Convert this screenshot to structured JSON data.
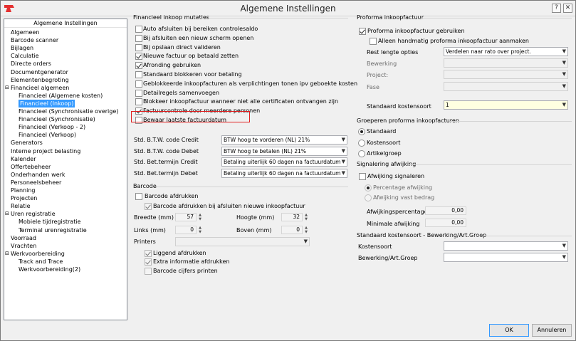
{
  "window": {
    "title": "Algemene Instellingen"
  },
  "tree": {
    "header": "Algemene Instellingen",
    "items": [
      "Algemeen",
      "Barcode scanner",
      "Bijlagen",
      "Calculatie",
      "Directe orders",
      "Documentgenerator",
      "Elementenbegroting",
      "Financieel algemeen",
      "Financieel (Algemene kosten)",
      "Financieel (Inkoop)",
      "Financieel (Synchronisatie overige)",
      "Financieel (Synchronisatie)",
      "Financieel (Verkoop - 2)",
      "Financieel (Verkoop)",
      "Generators",
      "Interne project belasting",
      "Kalender",
      "Offertebeheer",
      "Onderhanden werk",
      "Personeelsbeheer",
      "Planning",
      "Projecten",
      "Relatie",
      "Uren registratie",
      "Mobiele tijdregistratie",
      "Terminal urenregistratie",
      "Voorraad",
      "Vrachten",
      "Werkvoorbereiding",
      "Track and Trace",
      "Werkvoorbereiding(2)"
    ]
  },
  "mutaties": {
    "header": "Financieel inkoop mutaties",
    "checks": [
      {
        "label": "Auto afsluiten bij bereiken controlesaldo",
        "checked": false
      },
      {
        "label": "Bij afsluiten een nieuw scherm openen",
        "checked": false
      },
      {
        "label": "Bij opslaan direct valideren",
        "checked": false
      },
      {
        "label": "Nieuwe factuur op betaald zetten",
        "checked": true
      },
      {
        "label": "Afronding gebruiken",
        "checked": true
      },
      {
        "label": "Standaard blokkeren voor betaling",
        "checked": false
      },
      {
        "label": "Geblokkeerde inkoopfacturen als verplichtingen tonen ipv geboekte kosten",
        "checked": false
      },
      {
        "label": "Detailregels samenvoegen",
        "checked": false
      },
      {
        "label": "Blokkeer inkoopfactuur wanneer niet alle certificaten ontvangen zijn",
        "checked": false
      },
      {
        "label": "Factuurcontrole door meerdere personen",
        "checked": true
      },
      {
        "label": "Bewaar laatste factuurdatum",
        "checked": false
      }
    ],
    "fields": [
      {
        "label": "Std. B.T.W. code Credit",
        "value": "BTW hoog te vorderen (NL) 21%"
      },
      {
        "label": "Std. B.T.W. code Debet",
        "value": "BTW hoog te betalen (NL) 21%"
      },
      {
        "label": "Std. Bet.termijn Credit",
        "value": "Betaling uiterlijk 60 dagen na factuurdatum"
      },
      {
        "label": "Std. Bet.termijn Debet",
        "value": "Betaling uiterlijk 60 dagen na factuurdatum"
      }
    ]
  },
  "barcode": {
    "header": "Barcode",
    "afdrukken": "Barcode afdrukken",
    "afsluiten": "Barcode afdrukken bij afsluiten nieuwe inkoopfactuur",
    "breedte_label": "Breedte (mm)",
    "breedte": "57",
    "hoogte_label": "Hoogte (mm)",
    "hoogte": "32",
    "links_label": "Links (mm)",
    "links": "0",
    "boven_label": "Boven (mm)",
    "boven": "0",
    "printers_label": "Printers",
    "liggend": "Liggend afdrukken",
    "extra": "Extra informatie afdrukken",
    "cijfers": "Barcode cijfers printen"
  },
  "proforma": {
    "header": "Proforma inkoopfactuur",
    "gebruiken": "Proforma inkoopfactuur gebruiken",
    "handmatig": "Alleen handmatig proforma inkoopfactuur aanmaken",
    "rest_label": "Rest lengte opties",
    "rest_value": "Verdelen naar rato over project.",
    "bewerking_label": "Bewerking",
    "project_label": "Project:",
    "fase_label": "Fase",
    "kostensoort_label": "Standaard kostensoort",
    "kostensoort_value": "1"
  },
  "groeperen": {
    "header": "Groeperen proforma inkoopfacturen",
    "options": [
      "Standaard",
      "Kostensoort",
      "Artikelgroep"
    ]
  },
  "signalering": {
    "header": "Signalering afwijking",
    "check": "Afwijking signaleren",
    "options": [
      "Percentage afwijking",
      "Afwijking vast bedrag"
    ],
    "pct_label": "Afwijkingspercentage",
    "pct_value": "0,00",
    "min_label": "Minimale afwijking",
    "min_value": "0,00"
  },
  "stdkost": {
    "header": "Standaard kostensoort - Bewerking/Art.Groep",
    "kostensoort_label": "Kostensoort",
    "bewerking_label": "Bewerking/Art.Groep"
  },
  "buttons": {
    "ok": "OK",
    "annuleren": "Annuleren"
  }
}
